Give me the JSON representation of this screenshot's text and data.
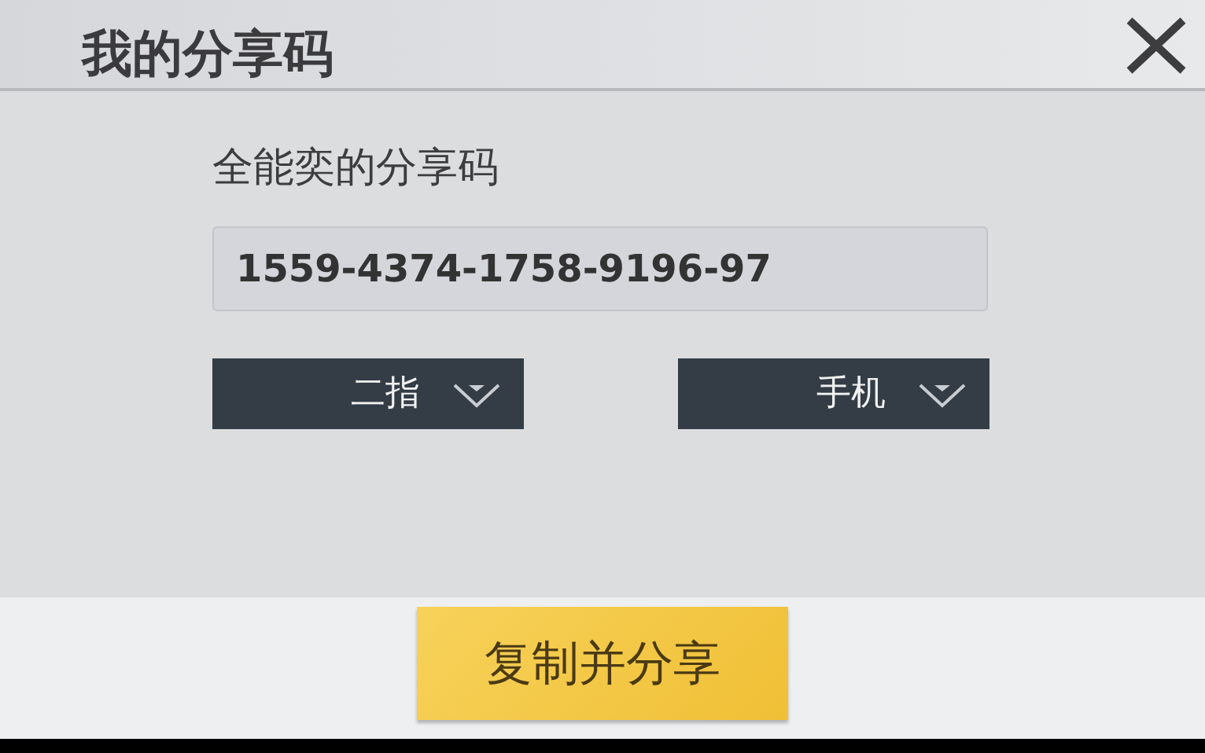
{
  "dialog": {
    "title": "我的分享码"
  },
  "share_code": {
    "label": "全能奕的分享码",
    "value": "1559-4374-1758-9196-97"
  },
  "dropdowns": [
    {
      "value": "二指"
    },
    {
      "value": "手机"
    }
  ],
  "action_button": {
    "label": "复制并分享"
  }
}
